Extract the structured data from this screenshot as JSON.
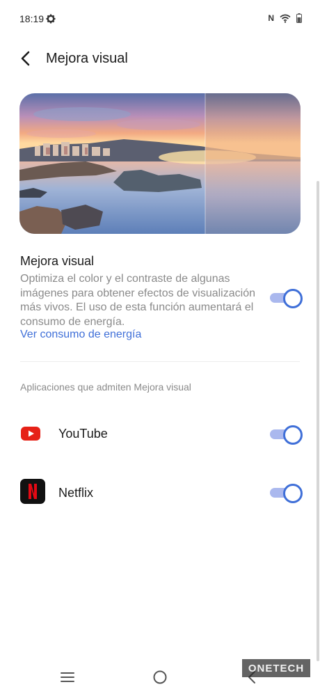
{
  "status": {
    "time": "18:19",
    "icons": [
      "gear-icon",
      "nfc-icon",
      "wifi-icon",
      "battery-icon"
    ],
    "nfc_label": "N"
  },
  "header": {
    "title": "Mejora visual",
    "back_icon": "back-arrow-icon"
  },
  "feature": {
    "title": "Mejora visual",
    "description": "Optimiza el color y el contraste de algunas imágenes para obtener efectos de visualización más vivos. El uso de esta función aumentará el consumo de energía.",
    "link": "Ver consumo de energía",
    "enabled": true
  },
  "apps": {
    "header": "Aplicaciones que admiten Mejora visual",
    "items": [
      {
        "name": "YouTube",
        "enabled": true,
        "icon": "youtube-icon"
      },
      {
        "name": "Netflix",
        "enabled": true,
        "icon": "netflix-icon"
      }
    ]
  },
  "nav": {
    "buttons": [
      "recents-button",
      "home-button",
      "back-button"
    ]
  },
  "watermark": {
    "text": "ONETECH"
  },
  "colors": {
    "accent": "#3f6fd8",
    "toggle_track": "#aab8ee",
    "text_secondary": "#8a8a8a",
    "youtube": "#e62117",
    "netflix": "#e50914"
  }
}
